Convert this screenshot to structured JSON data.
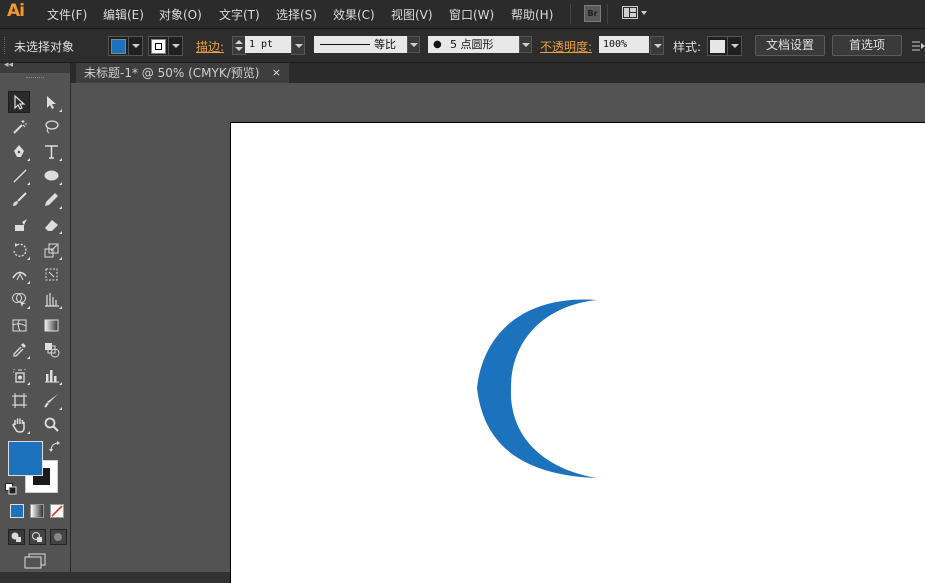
{
  "app": {
    "logo": "Ai"
  },
  "menubar": {
    "items": [
      "文件(F)",
      "编辑(E)",
      "对象(O)",
      "文字(T)",
      "选择(S)",
      "效果(C)",
      "视图(V)",
      "窗口(W)",
      "帮助(H)"
    ],
    "bridge_label": "Br"
  },
  "controlbar": {
    "selection_status": "未选择对象",
    "fill_color": "#1d72bd",
    "stroke_label": "描边:",
    "stroke_weight": "1 pt",
    "stroke_profile": "等比",
    "brush_label": "5 点圆形",
    "opacity_label": "不透明度:",
    "opacity_value": "100%",
    "style_label": "样式:",
    "document_setup": "文档设置",
    "preferences": "首选项"
  },
  "document": {
    "tab_title": "未标题-1* @ 50% (CMYK/预览)",
    "close_glyph": "×"
  },
  "artwork": {
    "shape": "crescent",
    "color": "#1d72bd"
  },
  "toolbox": {
    "fill_color": "#1d72bd",
    "stroke_color": "#ffffff"
  }
}
